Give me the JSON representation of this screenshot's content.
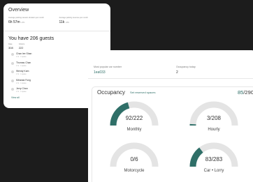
{
  "overview": {
    "title": "Overview",
    "stats": [
      {
        "label": "Average parking session duration per month",
        "value": "6h 57m",
        "unit": "+5%"
      },
      {
        "label": "Average parking revenue per month",
        "value": "11k",
        "unit": "+8%"
      }
    ]
  },
  "guests": {
    "title": "You have 206 guests",
    "meta": [
      {
        "key": "Date",
        "value": "308"
      },
      {
        "key": "Visitors",
        "value": "222"
      }
    ],
    "items": [
      {
        "name": "Chan lee Shan",
        "sub": "1 hr · 1 space"
      },
      {
        "name": "Thomas Chan",
        "sub": "1 hr · 1 space"
      },
      {
        "name": "Wendy Kam",
        "sub": "1 hr · 1 space"
      },
      {
        "name": "Miranda Fung",
        "sub": "1 hr · 1 space"
      },
      {
        "name": "Jerry Chan",
        "sub": "1 hr · 1 space"
      }
    ],
    "view_all": "View all"
  },
  "front": {
    "car_label": "Most popular car number",
    "car_value": "1ea033",
    "occ_today_label": "Occupancy today",
    "occ_today_value": "2"
  },
  "occupancy": {
    "title": "Occupancy",
    "link": "Set reserved spaces",
    "total_used": "85",
    "total_all": "/290",
    "gauges": [
      {
        "key": "monthly",
        "value": "92/222",
        "label": "Monthly",
        "fraction": 0.414
      },
      {
        "key": "hourly",
        "value": "3/208",
        "label": "Hourly",
        "fraction": 0.014
      },
      {
        "key": "motorcycle",
        "value": "0/6",
        "label": "Motorcycle",
        "fraction": 0
      },
      {
        "key": "car-lorry",
        "value": "83/283",
        "label": "Car • Lorry",
        "fraction": 0.293
      }
    ]
  },
  "colors": {
    "accent": "#2f6f68",
    "track": "#e4e4e4"
  }
}
